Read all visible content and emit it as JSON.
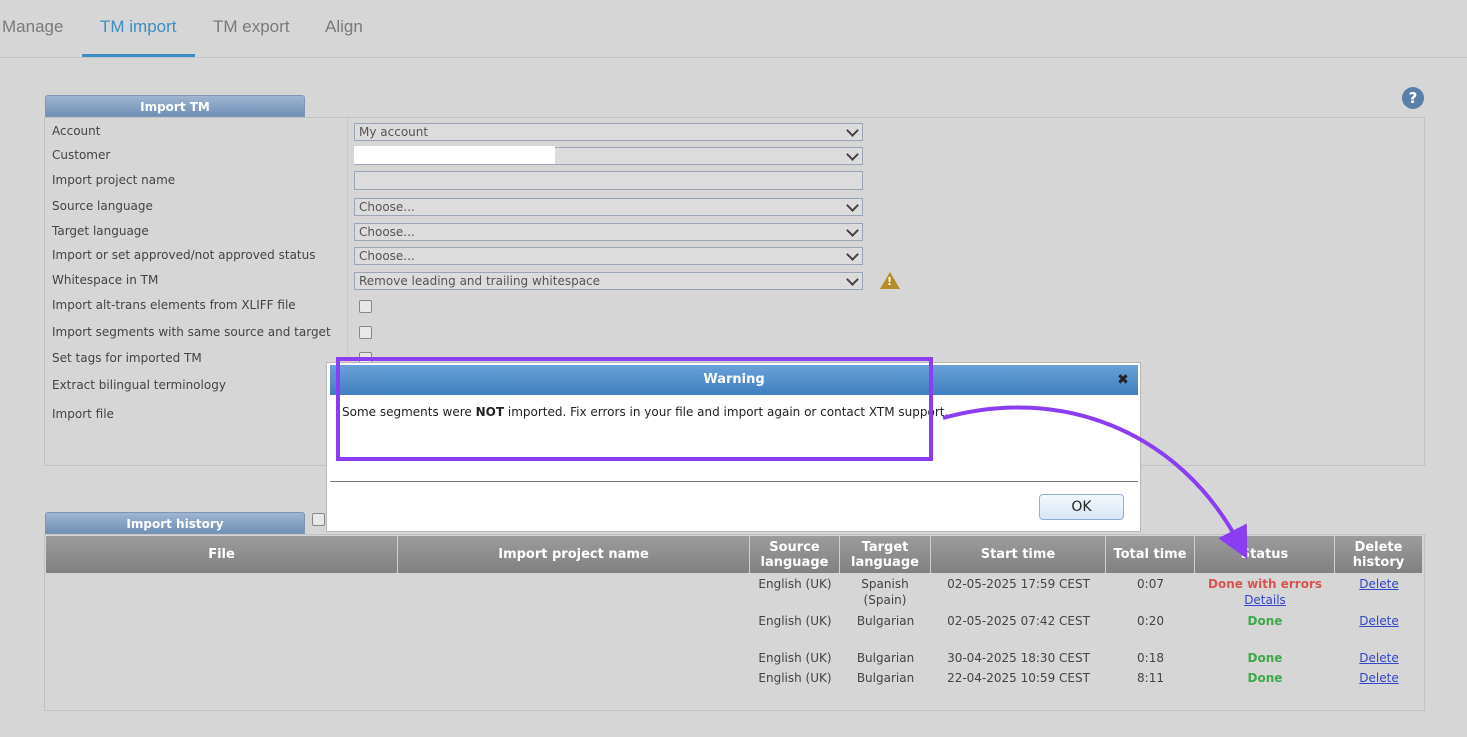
{
  "tabs": [
    {
      "label": "Manage"
    },
    {
      "label": "TM import"
    },
    {
      "label": "TM export"
    },
    {
      "label": "Align"
    }
  ],
  "import_panel": {
    "title": "Import TM",
    "labels": {
      "account": "Account",
      "customer": "Customer",
      "project_name": "Import project name",
      "source_language": "Source language",
      "target_language": "Target language",
      "approved_status": "Import or set approved/not approved status",
      "whitespace": "Whitespace in TM",
      "alt_trans": "Import alt-trans elements from XLIFF file",
      "same_source_target": "Import segments with same source and target",
      "set_tags": "Set tags for imported TM",
      "extract_terminology": "Extract bilingual terminology",
      "import_file": "Import file"
    },
    "values": {
      "account": "My account",
      "source_language": "Choose...",
      "target_language": "Choose...",
      "approved_status": "Choose...",
      "whitespace": "Remove leading and trailing whitespace"
    }
  },
  "history_panel": {
    "title": "Import history",
    "columns": {
      "file": "File",
      "project_name": "Import project name",
      "source_language": "Source language",
      "target_language": "Target language",
      "start_time": "Start time",
      "total_time": "Total time",
      "status": "Status",
      "delete_history": "Delete history"
    },
    "rows": [
      {
        "source": "English (UK)",
        "target": "Spanish (Spain)",
        "start": "02-05-2025 17:59 CEST",
        "total": "0:07",
        "status": "Done with errors",
        "details": "Details",
        "delete": "Delete"
      },
      {
        "source": "English (UK)",
        "target": "Bulgarian",
        "start": "02-05-2025 07:42 CEST",
        "total": "0:20",
        "status": "Done",
        "delete": "Delete"
      },
      {
        "source": "English (UK)",
        "target": "Bulgarian",
        "start": "30-04-2025 18:30 CEST",
        "total": "0:18",
        "status": "Done",
        "delete": "Delete"
      },
      {
        "source": "English (UK)",
        "target": "Bulgarian",
        "start": "22-04-2025 10:59 CEST",
        "total": "8:11",
        "status": "Done",
        "delete": "Delete"
      }
    ]
  },
  "dialog": {
    "title": "Warning",
    "message_before": "Some segments were ",
    "message_bold": "NOT",
    "message_after": " imported. Fix errors in your file and import again or contact XTM support.",
    "ok_label": "OK"
  },
  "icons": {
    "help": "help-icon",
    "warning": "warning-icon",
    "close": "close-icon",
    "chevron": "chevron-down-icon"
  },
  "colors": {
    "accent_tab": "#3b8fc4",
    "highlight": "#8b3df2",
    "error": "#d9534f",
    "done": "#3ea84a"
  }
}
